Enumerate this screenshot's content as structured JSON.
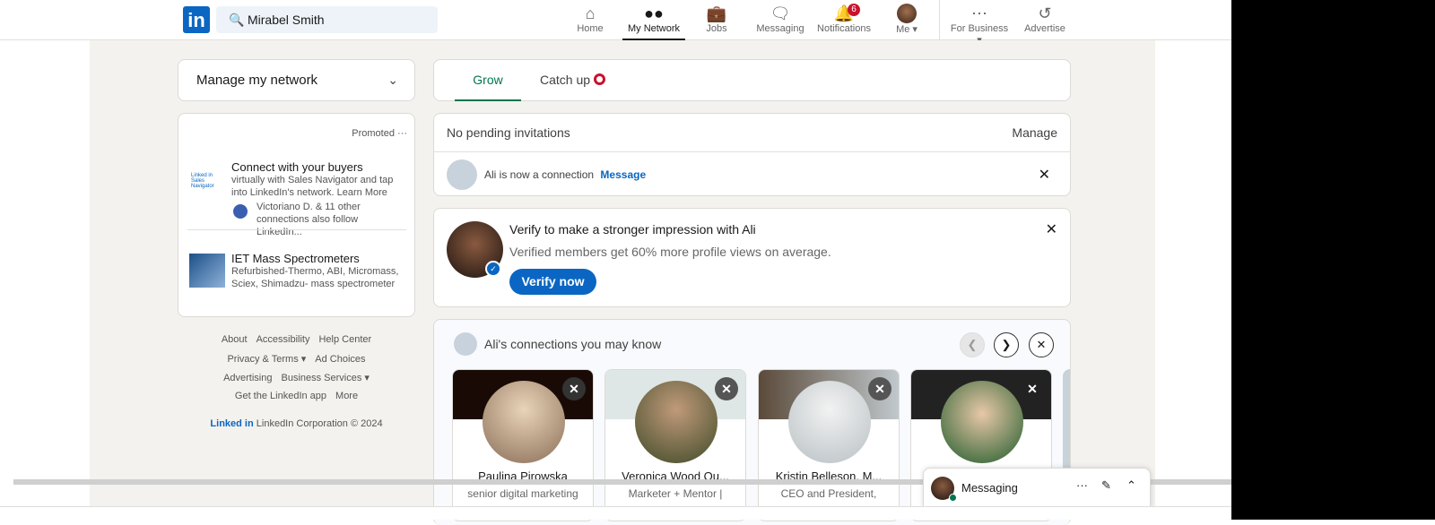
{
  "header": {
    "search_value": "Mirabel Smith",
    "logo": "in",
    "nav": [
      {
        "label": "Home",
        "icon": "home-icon"
      },
      {
        "label": "My Network",
        "icon": "network-icon"
      },
      {
        "label": "Jobs",
        "icon": "briefcase-icon"
      },
      {
        "label": "Messaging",
        "icon": "chat-icon"
      },
      {
        "label": "Notifications",
        "icon": "bell-icon",
        "badge": "6"
      },
      {
        "label": "Me ▾",
        "icon": "avatar"
      },
      {
        "label": "For Business ▾",
        "icon": "grid-icon"
      },
      {
        "label": "Advertise",
        "icon": "advertise-icon"
      }
    ]
  },
  "sidebar": {
    "manage": "Manage my network",
    "promoted": "Promoted",
    "ads": [
      {
        "title": "Connect with your buyers",
        "desc": "virtually with Sales Navigator and tap into LinkedIn's network. Learn More",
        "social": "Victoriano D. & 11 other connections also follow LinkedIn...",
        "logo": "Linked in Sales Navigator"
      },
      {
        "title": "IET Mass Spectrometers",
        "desc": "Refurbished-Thermo, ABI, Micromass, Sciex, Shimadzu- mass spectrometer"
      }
    ],
    "footer": [
      [
        "About",
        "Accessibility",
        "Help Center"
      ],
      [
        "Privacy & Terms ▾",
        "Ad Choices"
      ],
      [
        "Advertising",
        "Business Services ▾"
      ],
      [
        "Get the LinkedIn app",
        "More"
      ]
    ],
    "copyright_logo": "Linked in",
    "copyright": "LinkedIn Corporation © 2024"
  },
  "main": {
    "tabs": [
      {
        "label": "Grow",
        "active": true
      },
      {
        "label": "Catch up"
      }
    ],
    "invitations": {
      "text": "No pending invitations",
      "manage": "Manage",
      "connection": "Ali is now a connection",
      "message": "Message"
    },
    "verify": {
      "title": "Verify to make a stronger impression with Ali",
      "desc": "Verified members get 60% more profile views on average.",
      "button": "Verify now"
    },
    "pymk": {
      "title": "Ali's connections you may know",
      "people": [
        {
          "name": "Paulina Pirowska",
          "headline": "senior digital marketing"
        },
        {
          "name": "Veronica Wood Qu...",
          "headline": "Marketer + Mentor |"
        },
        {
          "name": "Kristin Belleson, M...",
          "headline": "CEO and President,"
        },
        {
          "name": "",
          "headline": ""
        }
      ]
    }
  },
  "messaging": {
    "label": "Messaging"
  },
  "colors": {
    "brand": "#0a66c2",
    "active_tab": "#01754f",
    "badge": "#cb112d"
  }
}
